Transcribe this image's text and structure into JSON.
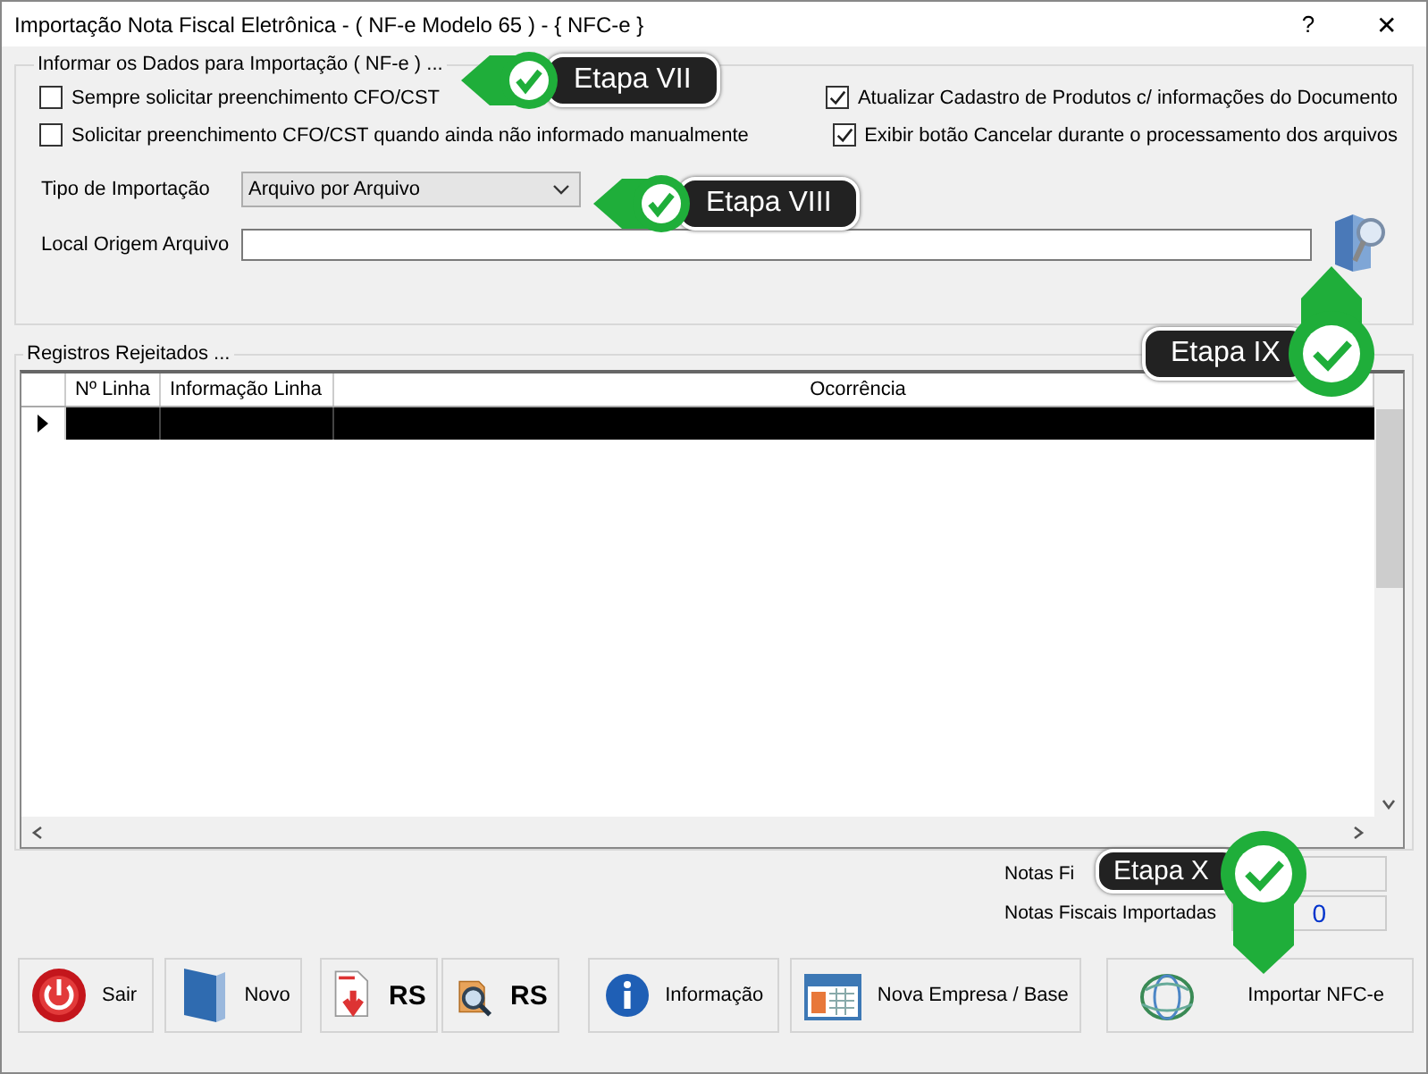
{
  "window": {
    "title": "Importação Nota Fiscal Eletrônica - ( NF-e Modelo 65 ) - { NFC-e }",
    "help": "?",
    "close": "✕"
  },
  "import_group": {
    "title": "Informar os Dados para Importação ( NF-e ) ...",
    "options": [
      {
        "label": "Sempre solicitar preenchimento CFO/CST",
        "checked": false
      },
      {
        "label": "Atualizar Cadastro de Produtos c/ informações do Documento",
        "checked": true
      },
      {
        "label": "Solicitar preenchimento CFO/CST quando ainda não informado manualmente",
        "checked": false
      },
      {
        "label": "Exibir botão Cancelar durante o processamento dos arquivos",
        "checked": true
      }
    ],
    "import_type": {
      "label": "Tipo de Importação",
      "value": "Arquivo por Arquivo"
    },
    "source": {
      "label": "Local Origem Arquivo"
    }
  },
  "rejected_group": {
    "title": "Registros Rejeitados ...",
    "table": {
      "columns": [
        "Nº Linha",
        "Informação Linha",
        "Ocorrência"
      ],
      "rows": [
        {
          "selected": true
        }
      ]
    }
  },
  "stats": [
    {
      "label": "Notas Fi"
    },
    {
      "label": "Notas Fiscais Importadas",
      "value": "0"
    }
  ],
  "buttons": [
    {
      "kind": "power",
      "label": "Sair"
    },
    {
      "kind": "new",
      "label": "Novo"
    },
    {
      "kind": "pdf",
      "label": "RS"
    },
    {
      "kind": "search",
      "label": "RS"
    },
    {
      "kind": "info",
      "label": "Informação"
    },
    {
      "kind": "calendar",
      "label": "Nova Empresa / Base"
    },
    {
      "kind": "nfe",
      "label": "Importar NFC-e"
    }
  ],
  "callouts": [
    {
      "label": "Etapa VII",
      "kind": "left"
    },
    {
      "label": "Etapa VIII",
      "kind": "left"
    },
    {
      "label": "Etapa IX",
      "kind": "up"
    },
    {
      "label": "Etapa X",
      "kind": "down"
    }
  ]
}
